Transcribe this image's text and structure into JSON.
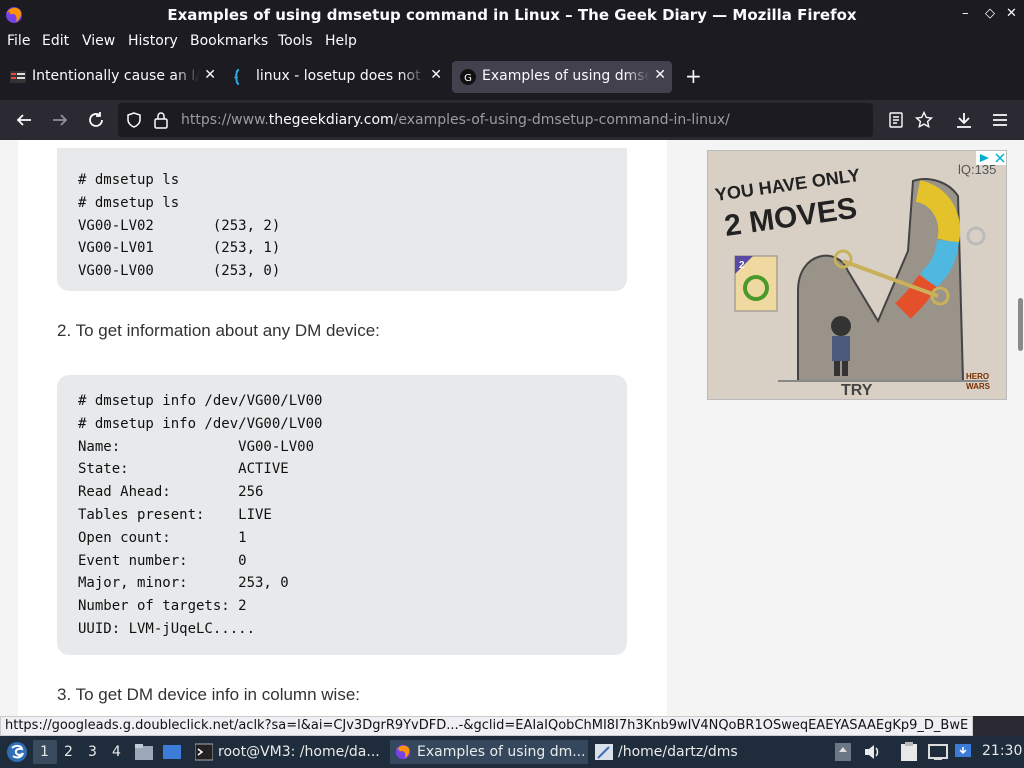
{
  "window": {
    "title": "Examples of using dmsetup command in Linux – The Geek Diary — Mozilla Firefox",
    "controls": [
      "–",
      "◇",
      "✕"
    ]
  },
  "menu": [
    "File",
    "Edit",
    "View",
    "History",
    "Bookmarks",
    "Tools",
    "Help"
  ],
  "tabs": [
    {
      "label": "Intentionally cause an I/O error in Linux",
      "active": false
    },
    {
      "label": "linux - losetup does not fail",
      "active": false
    },
    {
      "label": "Examples of using dmsetup",
      "active": true
    }
  ],
  "url": {
    "prefix": "https://www.",
    "domain": "thegeekdiary.com",
    "path": "/examples-of-using-dmsetup-command-in-linux/"
  },
  "article": {
    "code1": [
      "# dmsetup ls",
      "# dmsetup ls",
      "VG00-LV02       (253, 2)",
      "VG00-LV01       (253, 1)",
      "VG00-LV00       (253, 0)"
    ],
    "para2": "2. To get information about any DM device:",
    "code2": [
      "# dmsetup info /dev/VG00/LV00",
      "# dmsetup info /dev/VG00/LV00",
      "Name:              VG00-LV00",
      "State:             ACTIVE",
      "Read Ahead:        256",
      "Tables present:    LIVE",
      "Open count:        1",
      "Event number:      0",
      "Major, minor:      253, 0",
      "Number of targets: 2",
      "UUID: LVM-jUqeLC....."
    ],
    "para3": "3. To get DM device info in column wise:"
  },
  "ad": {
    "headline1": "YOU HAVE ONLY",
    "headline2": "2 MOVES",
    "level": "lQ:135",
    "card_number": "2",
    "cta": "TRY",
    "brand1": "HERO",
    "brand2": "WARS"
  },
  "status_link": "https://googleads.g.doubleclick.net/aclk?sa=l&ai=CJv3DgrR9YvDFD...-&gclid=EAIaIQobChMI8I7h3Knb9wIV4NQoBR1OSweqEAEYASAAEgKp9_D_BwE",
  "taskbar": {
    "workspaces": [
      "1",
      "2",
      "3",
      "4"
    ],
    "tasks": [
      "root@VM3: /home/da...",
      "Examples of using dm...",
      "/home/dartz/dms"
    ],
    "clock": "21:30"
  },
  "colors": {
    "chrome": "#1c1b22",
    "toolbar": "#2b2a33",
    "codebg": "#e7e9eb",
    "taskbar": "#1f2c3b"
  }
}
